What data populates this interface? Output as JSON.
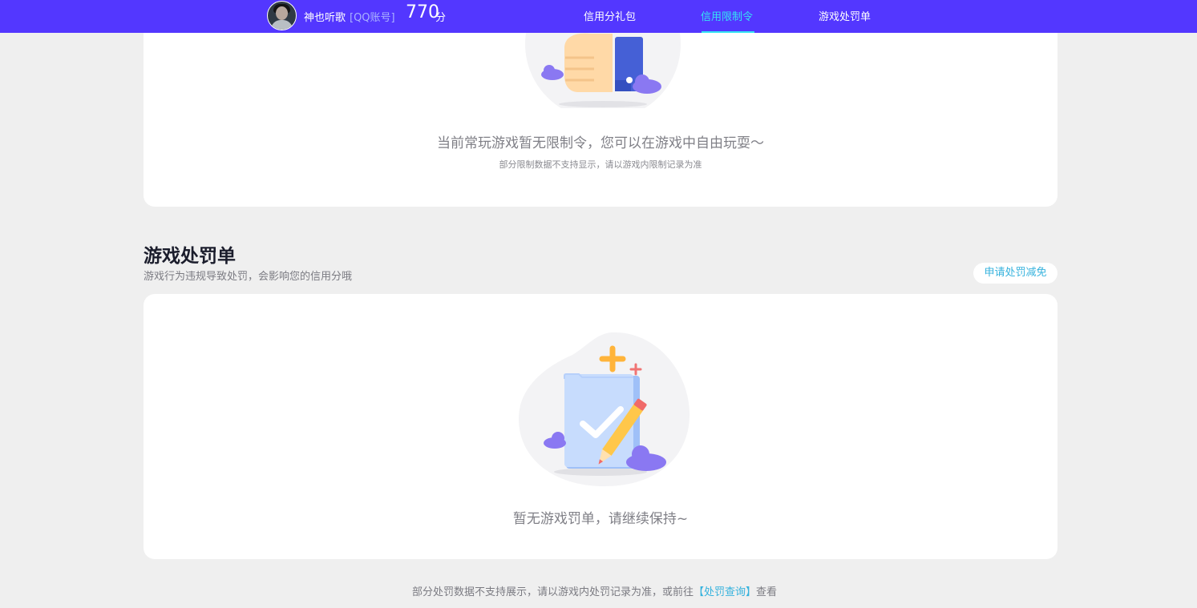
{
  "header": {
    "username": "神也听歌",
    "account_tag": "[QQ账号]",
    "score": "770",
    "score_unit": "分",
    "nav": [
      {
        "label": "信用分礼包",
        "active": false
      },
      {
        "label": "信用限制令",
        "active": true
      },
      {
        "label": "游戏处罚单",
        "active": false
      }
    ],
    "accent_color": "#5337ff",
    "active_color": "#35e4f4"
  },
  "restriction_card": {
    "message": "当前常玩游戏暂无限制令，您可以在游戏中自由玩耍～",
    "note": "部分限制数据不支持显示，请以游戏内限制记录为准",
    "illustration": "thumbs-up-illustration"
  },
  "penalty_section": {
    "title": "游戏处罚单",
    "description": "游戏行为违规导致处罚，会影响您的信用分哦",
    "appeal_button": "申请处罚减免",
    "empty_message": "暂无游戏罚单，请继续保持~",
    "illustration": "checklist-pencil-illustration"
  },
  "footer": {
    "text_before": "部分处罚数据不支持展示，请以游戏内处罚记录为准，或前往",
    "link": "【处罚查询】",
    "text_after": "查看",
    "link_color": "#35b2dd"
  }
}
